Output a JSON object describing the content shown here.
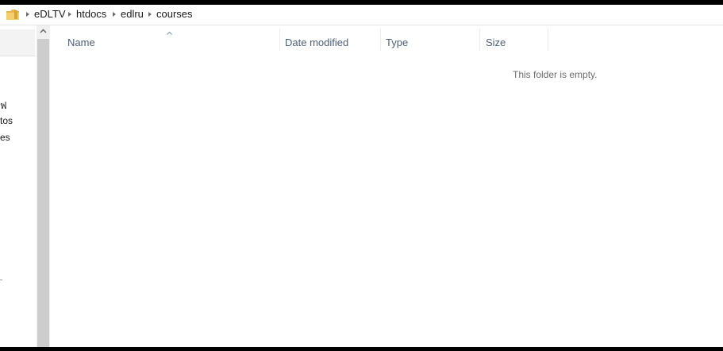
{
  "address_bar": {
    "breadcrumbs": [
      "eDLTV",
      "htdocs",
      "edlru",
      "courses"
    ],
    "folder_icon": "folder-icon",
    "separator_icon": "chevron-right-icon"
  },
  "nav_pane": {
    "items": [
      "ฟ",
      "tos",
      "es"
    ]
  },
  "file_list": {
    "columns": {
      "name": "Name",
      "date_modified": "Date modified",
      "type": "Type",
      "size": "Size"
    },
    "sort_icon": "sort-ascending-icon",
    "empty_message": "This folder is empty."
  },
  "colors": {
    "header_text": "#4c607a",
    "scrollbar_thumb": "#cdcdcd",
    "folder": "#e8b94a"
  }
}
